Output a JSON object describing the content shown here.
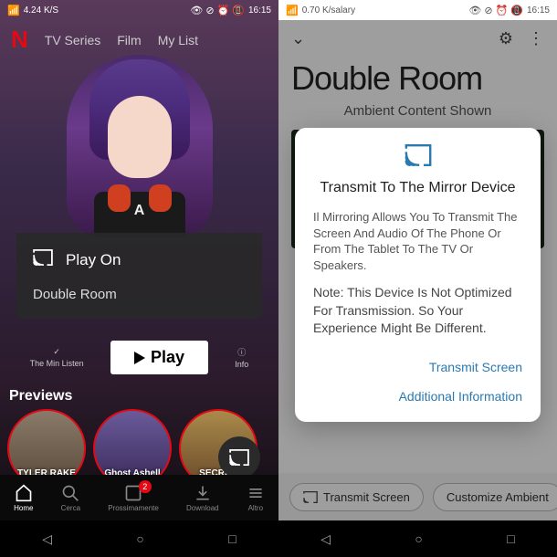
{
  "left": {
    "status": {
      "speed": "4.24 K/S",
      "time": "16:15"
    },
    "logo": "N",
    "nav": [
      "TV Series",
      "Film",
      "My List"
    ],
    "hero_letter": "A",
    "overlay": {
      "play_on": "Play On",
      "device": "Double Room"
    },
    "actions": {
      "mylist": "The Min Listen",
      "play": "Play",
      "info": "Info"
    },
    "previews_label": "Previews",
    "previews": [
      "TYLER\nRAKE",
      "Ghost Ashell",
      "SECRED"
    ],
    "bottom": {
      "home": "Home",
      "search": "Cerca",
      "soon": "Prossimamente",
      "download": "Download",
      "other": "Altro",
      "badge": "2"
    }
  },
  "right": {
    "status": {
      "speed": "0.70 K/salary",
      "time": "16:15"
    },
    "title": "Double Room",
    "subtitle": "Ambient Content Shown",
    "dialog": {
      "title": "Transmit To The Mirror Device",
      "body": "Il Mirroring Allows You To Transmit The Screen And Audio Of The Phone Or From The Tablet To The TV Or Speakers.",
      "note": "Note: This Device Is Not Optimized For Transmission. So Your Experience Might Be Different.",
      "action1": "Transmit Screen",
      "action2": "Additional Information"
    },
    "chips": {
      "transmit": "Transmit Screen",
      "customize": "Customize Ambient"
    }
  }
}
